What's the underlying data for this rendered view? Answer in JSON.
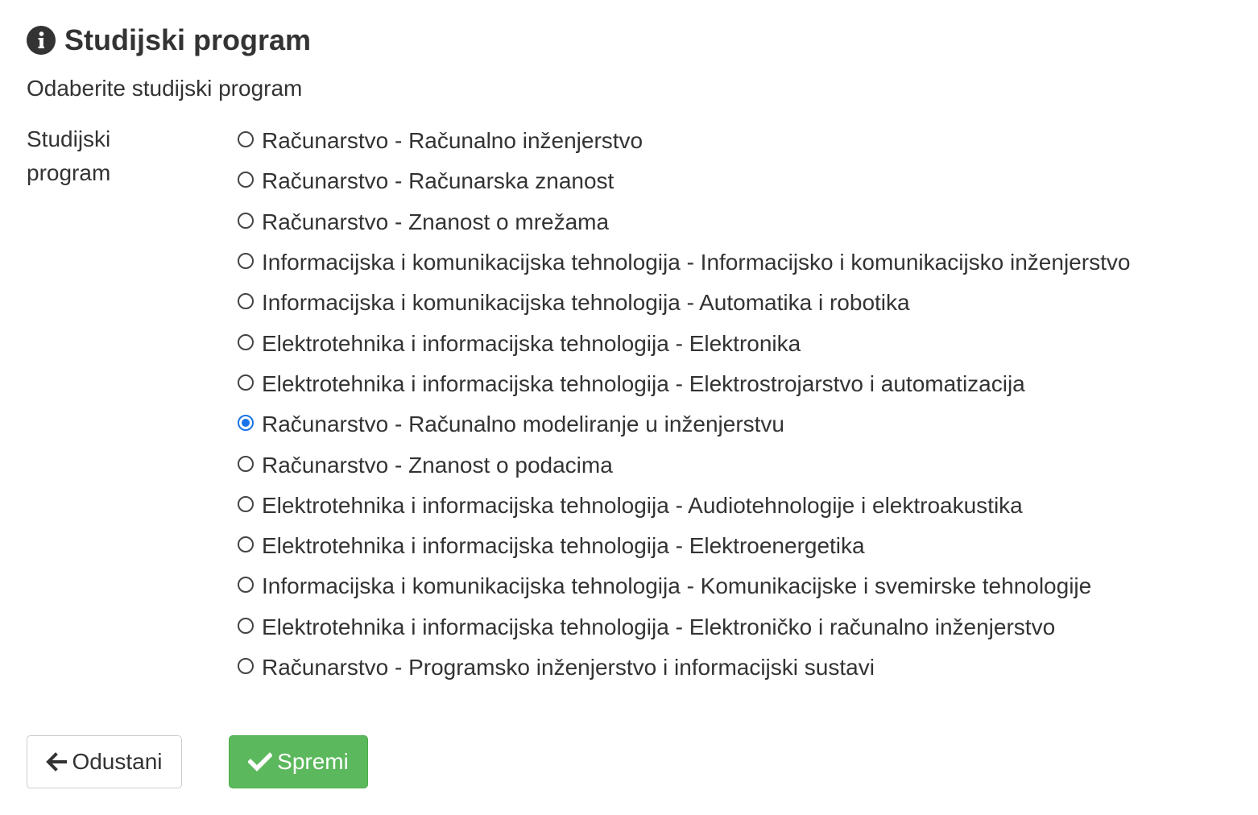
{
  "header": {
    "title": "Studijski program",
    "icon": "info-circle-icon"
  },
  "subtitle": "Odaberite studijski program",
  "form": {
    "field_label": "Studijski program",
    "selected_index": 7,
    "options": [
      "Računarstvo - Računalno inženjerstvo",
      "Računarstvo - Računarska znanost",
      "Računarstvo - Znanost o mrežama",
      "Informacijska i komunikacijska tehnologija - Informacijsko i komunikacijsko inženjerstvo",
      "Informacijska i komunikacijska tehnologija - Automatika i robotika",
      "Elektrotehnika i informacijska tehnologija - Elektronika",
      "Elektrotehnika i informacijska tehnologija - Elektrostrojarstvo i automatizacija",
      "Računarstvo - Računalno modeliranje u inženjerstvu",
      "Računarstvo - Znanost o podacima",
      "Elektrotehnika i informacijska tehnologija - Audiotehnologije i elektroakustika",
      "Elektrotehnika i informacijska tehnologija - Elektroenergetika",
      "Informacijska i komunikacijska tehnologija - Komunikacijske i svemirske tehnologije",
      "Elektrotehnika i informacijska tehnologija - Elektroničko i računalno inženjerstvo",
      "Računarstvo - Programsko inženjerstvo i informacijski sustavi"
    ]
  },
  "buttons": {
    "cancel_label": "Odustani",
    "cancel_icon": "arrow-left-icon",
    "save_label": "Spremi",
    "save_icon": "check-icon"
  },
  "colors": {
    "text": "#333333",
    "radio_selected": "#1a73e8",
    "save_button": "#5cb85c",
    "cancel_border": "#cccccc"
  }
}
